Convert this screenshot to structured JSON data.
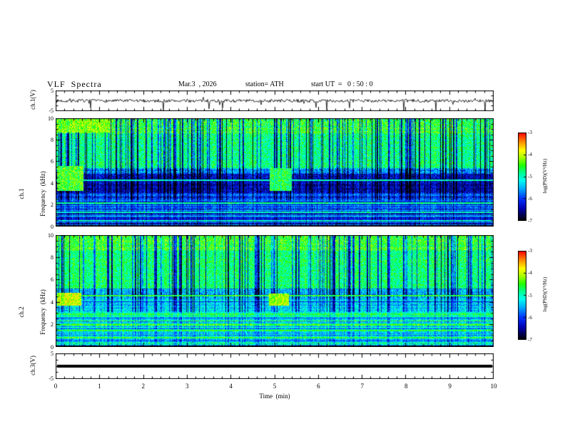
{
  "header": {
    "title": "VLF  Spectra",
    "date": "Mar.3  , 2026",
    "station": "station= ATH",
    "start_ut": "start UT  =   0 : 50 : 0"
  },
  "xaxis": {
    "label": "Time  (min)",
    "min": 0,
    "max": 10,
    "ticks": [
      0,
      1,
      2,
      3,
      4,
      5,
      6,
      7,
      8,
      9,
      10
    ]
  },
  "colormap": {
    "vmin": -7,
    "vmax": -3,
    "stops": [
      [
        0,
        "#000000"
      ],
      [
        0.06,
        "#00004d"
      ],
      [
        0.14,
        "#0000b4"
      ],
      [
        0.25,
        "#0033ff"
      ],
      [
        0.36,
        "#00aaff"
      ],
      [
        0.46,
        "#00ffee"
      ],
      [
        0.55,
        "#00ff88"
      ],
      [
        0.63,
        "#22ff00"
      ],
      [
        0.72,
        "#aaff00"
      ],
      [
        0.8,
        "#ffff00"
      ],
      [
        0.9,
        "#ff8800"
      ],
      [
        1,
        "#ff0000"
      ]
    ]
  },
  "colorbars": [
    {
      "label": "log(PSD)(V²/Hz)",
      "ticks": [
        "-3",
        "-4",
        "-5",
        "-6",
        "-7"
      ]
    },
    {
      "label": "log(PSD)(V²/Hz)",
      "ticks": [
        "-3",
        "-4",
        "-5",
        "-6",
        "-7"
      ]
    }
  ],
  "chart_data": [
    {
      "id": "waveform",
      "type": "line",
      "ylabel": "ch.1(V)",
      "xlim": [
        0,
        10
      ],
      "ylim": [
        -5,
        5
      ],
      "ytick_labels": [
        "5",
        "-5"
      ],
      "seed": 7,
      "noise_amp": 0.75,
      "spike_prob": 0.035,
      "description": "ch.1 voltage vs time: continuous band-limited noise of about ±1 V around 0 V with many impulsive negative spikes reaching down to -5 V over the 0-10 min record"
    },
    {
      "id": "spec1",
      "type": "heatmap",
      "ylabel": [
        "ch.1",
        "Frequency  (kHz)"
      ],
      "xlim": [
        0,
        10
      ],
      "ylim": [
        0,
        10
      ],
      "yticks": [
        0,
        2,
        4,
        6,
        8,
        10
      ],
      "colorbar_label": "log(PSD)(V²/Hz)",
      "seed": 101,
      "streaks": {
        "density": 0.22,
        "min": 0.9,
        "max": 2.4
      },
      "bands": [
        {
          "f": [
            8.6,
            10
          ],
          "base": -4.55,
          "row_jitter": 0.25,
          "noise": 0.55,
          "streak_weight": 1.0
        },
        {
          "f": [
            5.4,
            8.6
          ],
          "base": -4.8,
          "row_jitter": 0.2,
          "noise": 0.5,
          "streak_weight": 1.0
        },
        {
          "f": [
            4.9,
            5.4
          ],
          "base": -5.6,
          "row_jitter": 0.4,
          "noise": 0.5,
          "streak_weight": 1.0
        },
        {
          "f": [
            3.1,
            4.9
          ],
          "base": -6.35,
          "row_jitter": 0.3,
          "noise": 0.45,
          "streak_weight": 0.6
        },
        {
          "f": [
            2.4,
            3.1
          ],
          "base": -6.0,
          "row_jitter": 0.8,
          "noise": 0.4,
          "streak_weight": 0.5
        },
        {
          "f": [
            0.08,
            2.4
          ],
          "base": -6.15,
          "row_jitter": 1.3,
          "noise": 0.35,
          "streak_weight": 0.2
        },
        {
          "f": [
            0,
            0.08
          ],
          "base": -6.9,
          "row_jitter": 0.1,
          "noise": 0.1,
          "streak_weight": 0
        }
      ],
      "hlines": [
        {
          "f": 4.32,
          "v": -4.9,
          "w": 2
        },
        {
          "f": 2.18,
          "v": -4.7,
          "w": 2
        },
        {
          "f": 1.9,
          "v": -5.4,
          "w": 1
        },
        {
          "f": 1.32,
          "v": -4.9,
          "w": 2
        },
        {
          "f": 0.92,
          "v": -5.1,
          "w": 1
        },
        {
          "f": 0.55,
          "v": -4.95,
          "w": 2
        },
        {
          "f": 0.3,
          "v": -5.6,
          "w": 1
        }
      ],
      "patches": [
        {
          "t": [
            0.03,
            0.62
          ],
          "f": [
            3.3,
            5.6
          ],
          "v": -4.35,
          "noise": 0.55
        },
        {
          "t": [
            4.88,
            5.38
          ],
          "f": [
            3.3,
            5.45
          ],
          "v": -4.6,
          "noise": 0.55
        },
        {
          "t": [
            0.02,
            1.25
          ],
          "f": [
            8.7,
            10
          ],
          "v": -4.2,
          "noise": 0.5
        }
      ],
      "description": "ch.1 dynamic spectrum 0-10 kHz vs 0-10 min, jet colormap of log PSD from -7 (black/blue) to -3 (red): green background above ~5.5 kHz cut by dense dark-blue vertical sferic/interference streaks, a quiet dark-blue band 3-5 kHz with a narrow emission line near 4.3 kHz, strong horizontal banding (green lines on blue) below 2.5 kHz, and bright yellow-green patches near t=0-0.6 min and t≈5 min between 3.3 and 5.6 kHz"
    },
    {
      "id": "spec2",
      "type": "heatmap",
      "ylabel": [
        "ch.2",
        "Frequency  (kHz)"
      ],
      "xlim": [
        0,
        10
      ],
      "ylim": [
        0,
        10
      ],
      "yticks": [
        0,
        2,
        4,
        6,
        8,
        10
      ],
      "colorbar_label": "log(PSD)(V²/Hz)",
      "seed": 202,
      "streaks": {
        "density": 0.2,
        "min": 0.8,
        "max": 2.2
      },
      "bands": [
        {
          "f": [
            8.6,
            10
          ],
          "base": -4.5,
          "row_jitter": 0.25,
          "noise": 0.5,
          "streak_weight": 1.0
        },
        {
          "f": [
            5.2,
            8.6
          ],
          "base": -4.75,
          "row_jitter": 0.2,
          "noise": 0.45,
          "streak_weight": 1.0
        },
        {
          "f": [
            4.35,
            5.2
          ],
          "base": -5.5,
          "row_jitter": 0.5,
          "noise": 0.5,
          "streak_weight": 0.9
        },
        {
          "f": [
            3.1,
            4.35
          ],
          "base": -5.35,
          "row_jitter": 0.5,
          "noise": 0.45,
          "streak_weight": 0.6
        },
        {
          "f": [
            0.08,
            3.1
          ],
          "base": -5.15,
          "row_jitter": 0.9,
          "noise": 0.4,
          "streak_weight": 0.25
        },
        {
          "f": [
            0,
            0.08
          ],
          "base": -6.9,
          "row_jitter": 0.1,
          "noise": 0.1,
          "streak_weight": 0
        }
      ],
      "hlines": [
        {
          "f": 4.6,
          "v": -4.45,
          "w": 2
        },
        {
          "f": 4.05,
          "v": -6.1,
          "w": 1
        },
        {
          "f": 2.92,
          "v": -4.5,
          "w": 2
        },
        {
          "f": 2.55,
          "v": -5.9,
          "w": 1
        },
        {
          "f": 2.3,
          "v": -4.4,
          "w": 1
        },
        {
          "f": 2.0,
          "v": -4.35,
          "w": 2
        },
        {
          "f": 1.62,
          "v": -5.9,
          "w": 1
        },
        {
          "f": 1.45,
          "v": -4.5,
          "w": 2
        },
        {
          "f": 1.05,
          "v": -5.8,
          "w": 1
        },
        {
          "f": 0.82,
          "v": -4.45,
          "w": 2
        },
        {
          "f": 0.5,
          "v": -5.9,
          "w": 1
        },
        {
          "f": 0.32,
          "v": -4.6,
          "w": 1
        }
      ],
      "patches": [
        {
          "t": [
            0.03,
            0.58
          ],
          "f": [
            3.75,
            4.85
          ],
          "v": -3.95,
          "noise": 0.45
        },
        {
          "t": [
            4.86,
            5.32
          ],
          "f": [
            3.75,
            4.8
          ],
          "v": -4.1,
          "noise": 0.45
        }
      ],
      "description": "ch.2 dynamic spectrum 0-10 kHz vs 0-10 min: green background above ~5 kHz with dense dark-blue vertical streaks, emission line near 4.6 kHz, many bright green-yellow horizontal bands below 3 kHz over a cyan background, and intense yellow-orange patches near t=0-0.6 min and t≈5 min around 4-5 kHz"
    },
    {
      "id": "ch3",
      "type": "line",
      "ylabel": "ch.3(V)",
      "xlim": [
        0,
        10
      ],
      "ylim": [
        -5,
        5
      ],
      "ytick_labels": [
        "5",
        "-5"
      ],
      "constant_value": 0,
      "line_width": 4,
      "description": "ch.3 voltage vs time: flat thick black line at 0 V (no signal on channel 3)"
    }
  ]
}
